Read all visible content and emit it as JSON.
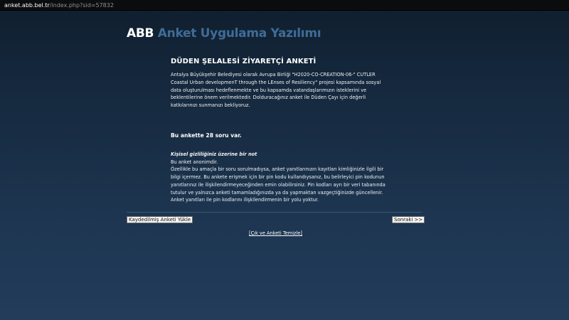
{
  "browser": {
    "url_host": "anket.abb.bel.tr",
    "url_path": "/index.php?sid=57832"
  },
  "brand": {
    "part1": "ABB",
    "part2": " Anket Uygulama Yazılımı"
  },
  "survey": {
    "title": "DÜDEN ŞELALESİ ZİYARETÇİ ANKETİ",
    "description": " Antalya Büyükşehir Belediyesi olarak Avrupa Birliği \"H2020-CO-CREATION-06-\" CUTLER Coastal Urban developmenT through the LEnses of Resiliency\" projesi kapsamında sosyal data oluşturulması hedeflenmekte ve bu kapsamda vatandaşlarımızın isteklerini ve beklentilerine önem verilmektedir. Dolduracağınız anket ile Düden Çayı için değerli katkılarınızı sunmanızı bekliyoruz.",
    "question_count_text": "Bu ankette 28 soru var."
  },
  "privacy": {
    "title": "Kişisel gizliliğiniz üzerine bir not",
    "line1": "Bu anket anonimdir.",
    "body": "Özellikle bu amaçla bir soru sorulmadıysa, anket yanıtlarınızın kayıtları kimliğinizle ilgili bir bilgi içermez. Bu ankete erişmek için bir pin kodu kullandıysanız, bu belirleyici pin kodunun yanıtlarınız ile ilişkilendirmeyeceğinden emin olabilirsiniz. Pin kodları ayrı bir veri tabanında tutulur ve yalnızca anketi tamamladığınızda ya da yapmaktan vazgeçtiğinizde güncellenir. Anket yanıtları ile pin kodlarını ilişkilendirmenin bir yolu yoktur."
  },
  "buttons": {
    "load_saved": "Kaydedilmiş Anketi Yükle",
    "next": "Sonraki >>",
    "exit_clear": "[Çık ve Anketi Temizle]"
  }
}
